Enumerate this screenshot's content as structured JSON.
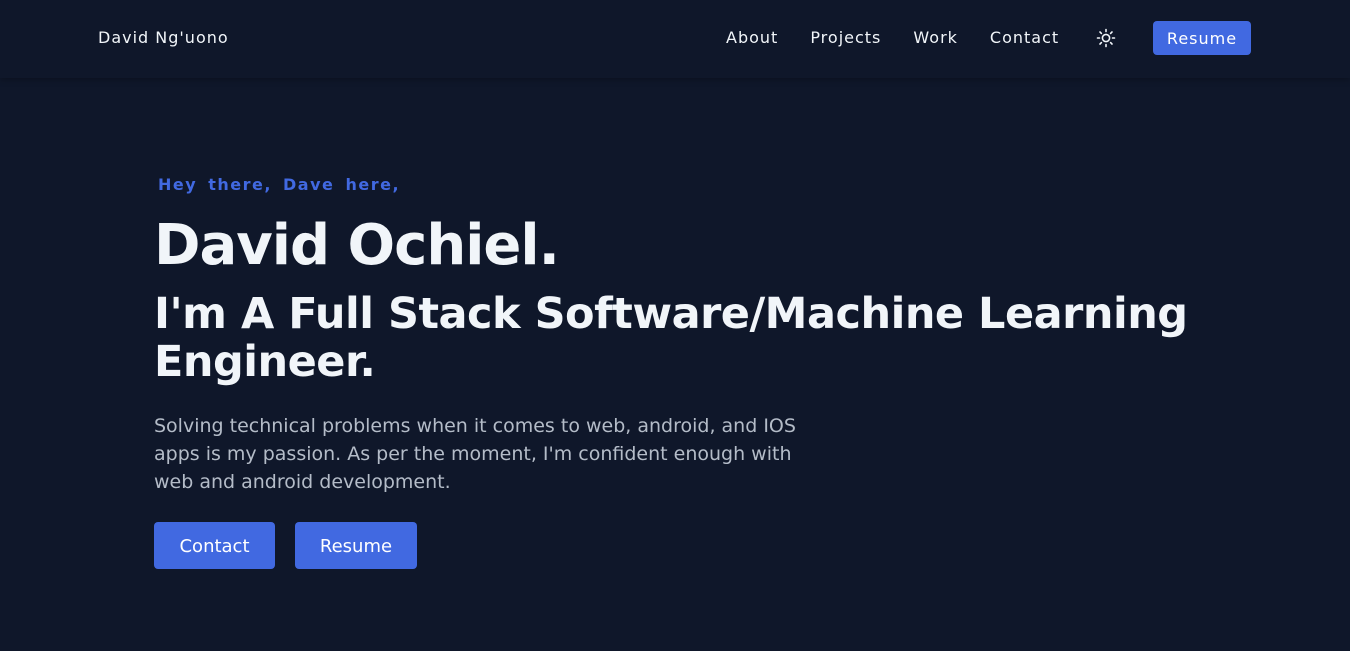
{
  "nav": {
    "brand": "David Ng'uono",
    "links": [
      "About",
      "Projects",
      "Work",
      "Contact"
    ],
    "theme_icon": "sun-icon",
    "resume_label": "Resume"
  },
  "hero": {
    "greeting": "Hey there, Dave here,",
    "name": "David Ochiel.",
    "title": "I'm A Full Stack Software/Machine Learning Engineer.",
    "description": "Solving technical problems when it comes to web, android, and IOS apps is my passion. As per the moment, I'm confident enough with web and android development.",
    "buttons": {
      "contact": "Contact",
      "resume": "Resume"
    }
  },
  "colors": {
    "background": "#0f172a",
    "accent": "#4169e1",
    "text": "#f1f5f9",
    "muted_text": "#b4bcc8"
  }
}
